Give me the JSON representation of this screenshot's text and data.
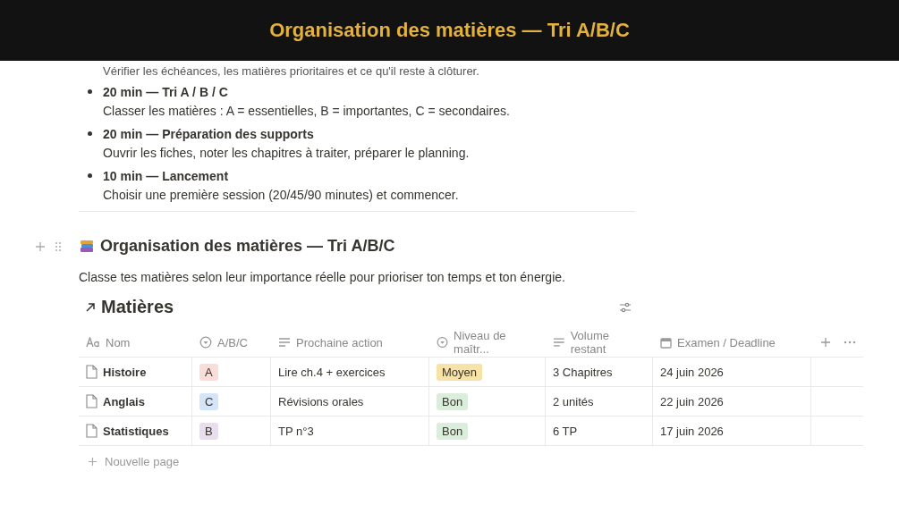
{
  "header": {
    "title": "Organisation des matières — Tri A/B/C"
  },
  "intro_line": "Vérifier les échéances, les matières prioritaires et ce qu'il reste à clôturer.",
  "steps": [
    {
      "title": "20 min — Tri A / B / C",
      "text": "Classer les matières : A = essentielles, B = importantes, C = secondaires."
    },
    {
      "title": "20 min — Préparation des supports",
      "text": "Ouvrir les fiches, noter les chapitres à traiter, préparer le planning."
    },
    {
      "title": "10 min — Lancement",
      "text": "Choisir une première session (20/45/90 minutes) et commencer."
    }
  ],
  "section": {
    "title": "Organisation des matières — Tri A/B/C",
    "description": "Classe tes matières selon leur importance réelle pour prioriser ton temps et ton énergie."
  },
  "database": {
    "title": "Matières",
    "columns": [
      {
        "label": "Nom",
        "kind": "title"
      },
      {
        "label": "A/B/C",
        "kind": "select"
      },
      {
        "label": "Prochaine action",
        "kind": "text"
      },
      {
        "label": "Niveau de maîtr...",
        "kind": "select"
      },
      {
        "label": "Volume restant",
        "kind": "text"
      },
      {
        "label": "Examen / Deadline",
        "kind": "date"
      }
    ],
    "rows": [
      {
        "name": "Histoire",
        "priority": {
          "label": "A",
          "color": "#fadcd9"
        },
        "action": "Lire ch.4 + exercices",
        "level": {
          "label": "Moyen",
          "color": "#f7e2a8"
        },
        "volume": "3 Chapitres",
        "deadline": "24 juin 2026"
      },
      {
        "name": "Anglais",
        "priority": {
          "label": "C",
          "color": "#d3e5f7"
        },
        "action": "Révisions orales",
        "level": {
          "label": "Bon",
          "color": "#dbeddb"
        },
        "volume": "2 unités",
        "deadline": "22 juin 2026"
      },
      {
        "name": "Statistiques",
        "priority": {
          "label": "B",
          "color": "#e8deee"
        },
        "action": "TP n°3",
        "level": {
          "label": "Bon",
          "color": "#dbeddb"
        },
        "volume": "6 TP",
        "deadline": "17 juin 2026"
      }
    ],
    "new_row": "Nouvelle page"
  }
}
